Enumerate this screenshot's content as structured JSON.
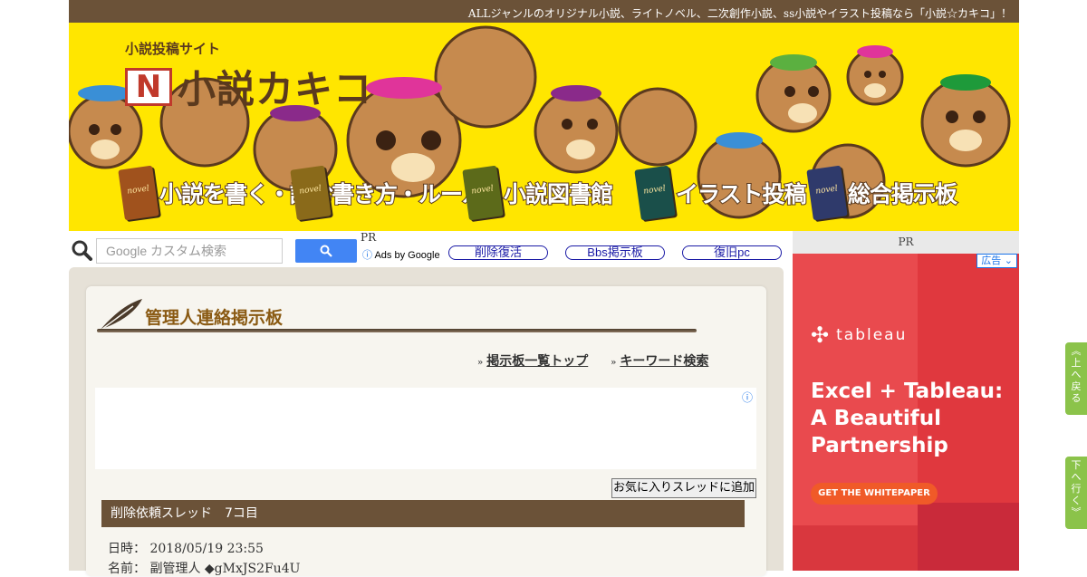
{
  "topbar": {
    "text": "ALLジャンルのオリジナル小説、ライトノベル、二次創作小説、ss小説やイラスト投稿なら「小説☆カキコ」！"
  },
  "logo": {
    "tagline": "小説投稿サイト",
    "letter": "N",
    "name": "小説カキコ"
  },
  "nav": [
    {
      "label": "小説を書く・読む",
      "book_word": "novel",
      "book_color": "#a0521d"
    },
    {
      "label": "書き方・ルール",
      "book_word": "novel",
      "book_color": "#8a6a1a"
    },
    {
      "label": "小説図書館",
      "book_word": "novel",
      "book_color": "#5c6a1a"
    },
    {
      "label": "イラスト投稿",
      "book_word": "novel",
      "book_color": "#1a4f4a"
    },
    {
      "label": "総合掲示板",
      "book_word": "novel",
      "book_color": "#2f3a6b"
    }
  ],
  "search": {
    "placeholder": "Google カスタム検索",
    "pr": "PR",
    "ads_by": "Ads by Google"
  },
  "pills": [
    "削除復活",
    "Bbs掲示板",
    "復旧pc"
  ],
  "board": {
    "title": "管理人連絡掲示板",
    "links": [
      "掲示板一覧トップ",
      "キーワード検索"
    ],
    "fav_button": "お気に入りスレッドに追加",
    "thread_title": "削除依頼スレッド　7コ目",
    "date_label": "日時：",
    "date_value": "2018/05/19 23:55",
    "name_label": "名前：",
    "name_value": "副管理人 ◆gMxJS2Fu4U"
  },
  "sidebar": {
    "pr": "PR",
    "ad_label": "広告",
    "brand": "tableau",
    "headline": [
      "Excel + Tableau:",
      "A Beautiful",
      "Partnership"
    ],
    "cta": "GET THE WHITEPAPER"
  },
  "float_buttons": {
    "up": [
      "上",
      "へ",
      "戻",
      "る"
    ],
    "down": [
      "下",
      "へ",
      "行",
      "く"
    ]
  },
  "colors": {
    "topbar": "#6b5238",
    "banner": "#ffe600",
    "panel": "#e6e1d7",
    "accent_title": "#8a5a13",
    "ad_bg": "#e94a4e",
    "float": "#8bc34a"
  }
}
